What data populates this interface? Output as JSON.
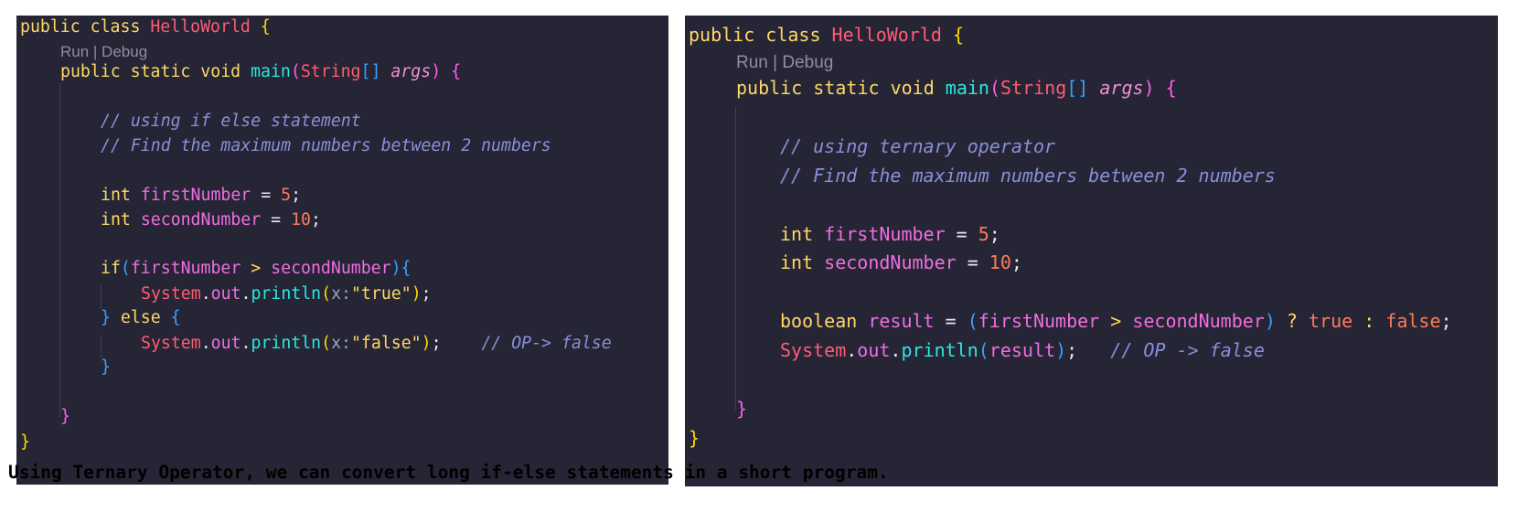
{
  "left_code": {
    "l1": {
      "kw": "public class ",
      "cls": "HelloWorld",
      "ob": " {"
    },
    "lens": "Run | Debug",
    "l2": {
      "kw": "public static void ",
      "fn": "main",
      "op": "(",
      "type": "String",
      "arr": "[] ",
      "param": "args",
      "cp": ")",
      "ob": " {"
    },
    "c1": "// using if else statement",
    "c2": "// Find the maximum numbers between 2 numbers",
    "d1": {
      "kw": "int ",
      "var": "firstNumber",
      "eq": " = ",
      "num": "5",
      "semi": ";"
    },
    "d2": {
      "kw": "int ",
      "var": "secondNumber",
      "eq": " = ",
      "num": "10",
      "semi": ";"
    },
    "if": {
      "kw": "if",
      "op": "(",
      "a": "firstNumber",
      "gt": " > ",
      "b": "secondNumber",
      "cp": ")",
      "ob": "{"
    },
    "p1": {
      "sys": "System",
      "dot1": ".",
      "out": "out",
      "dot2": ".",
      "fn": "println",
      "op": "(",
      "hint": "x:",
      "str": "\"true\"",
      "cp": ")",
      "semi": ";"
    },
    "else": {
      "cb": "} ",
      "kw": "else",
      "ob": " {"
    },
    "p2": {
      "sys": "System",
      "dot1": ".",
      "out": "out",
      "dot2": ".",
      "fn": "println",
      "op": "(",
      "hint": "x:",
      "str": "\"false\"",
      "cp": ")",
      "semi": ";",
      "cmt": "    // OP-> false"
    },
    "cb_if": "}",
    "cb_main": "}",
    "cb_class": "}"
  },
  "right_code": {
    "l1": {
      "kw": "public class ",
      "cls": "HelloWorld",
      "ob": " {"
    },
    "lens": "Run | Debug",
    "l2": {
      "kw": "public static void ",
      "fn": "main",
      "op": "(",
      "type": "String",
      "arr": "[] ",
      "param": "args",
      "cp": ")",
      "ob": " {"
    },
    "c1": "// using ternary operator",
    "c2": "// Find the maximum numbers between 2 numbers",
    "d1": {
      "kw": "int ",
      "var": "firstNumber",
      "eq": " = ",
      "num": "5",
      "semi": ";"
    },
    "d2": {
      "kw": "int ",
      "var": "secondNumber",
      "eq": " = ",
      "num": "10",
      "semi": ";"
    },
    "bool": {
      "kw": "boolean ",
      "var": "result",
      "eq": " = ",
      "op": "(",
      "a": "firstNumber",
      "gt": " > ",
      "b": "secondNumber",
      "cp": ")",
      "q": " ? ",
      "t": "true",
      "colon": " : ",
      "f": "false",
      "semi": ";"
    },
    "pr": {
      "sys": "System",
      "dot1": ".",
      "out": "out",
      "dot2": ".",
      "fn": "println",
      "op": "(",
      "var": "result",
      "cp": ")",
      "semi": ";",
      "cmt": "   // OP -> false"
    },
    "cb_main": "}",
    "cb_class": "}"
  },
  "caption": "Using Ternary Operator, we can convert long if-else statements in a short program."
}
